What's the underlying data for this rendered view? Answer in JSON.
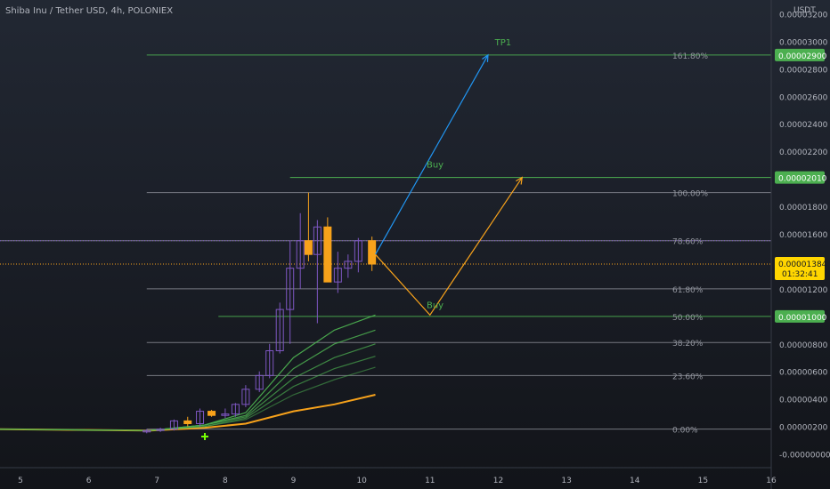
{
  "header": {
    "title": "Shiba Inu / Tether USD, 4h, POLONIEX"
  },
  "colors": {
    "up_candle": "#7e57c2",
    "down_candle": "#f7a21b",
    "grid_line": "#9598a1",
    "green_level": "#4caf50",
    "arrow_blue": "#2196f3",
    "arrow_orange": "#f7a21b",
    "price_label_bg": "#ffd600",
    "ma_fast": "#4caf50",
    "ma_slow": "#f7a21b"
  },
  "chart_data": {
    "type": "candlestick",
    "title": "Shiba Inu / Tether USD, 4h, POLONIEX",
    "ylabel": "USDT",
    "ylim": [
      -1e-07,
      3.3e-06
    ],
    "xlim": [
      4.7,
      16
    ],
    "x_ticks": [
      "5",
      "6",
      "7",
      "8",
      "9",
      "10",
      "11",
      "12",
      "13",
      "14",
      "15",
      "16"
    ],
    "x_tick_values": [
      5,
      6,
      7,
      8,
      9,
      10,
      11,
      12,
      13,
      14,
      15,
      16
    ],
    "y_ticks": [
      "0.00003200",
      "0.00003000",
      "0.00002800",
      "0.00002600",
      "0.00002400",
      "0.00002200",
      "0.00001800",
      "0.00001600",
      "0.00001200",
      "0.00000800",
      "0.00000600",
      "0.00000400",
      "0.00000200",
      "-0.00000000"
    ],
    "y_tick_values": [
      3.2e-06,
      3e-06,
      2.8e-06,
      2.6e-06,
      2.4e-06,
      2.2e-06,
      1.8e-06,
      1.6e-06,
      1.2e-06,
      8e-07,
      6e-07,
      4e-07,
      2e-07,
      0
    ],
    "fib_levels": [
      {
        "label": "161.80%",
        "value": 2.9e-06,
        "x_start": 6.85
      },
      {
        "label": "100.00%",
        "value": 1.9e-06,
        "x_start": 6.85
      },
      {
        "label": "78.60%",
        "value": 1.55e-06,
        "x_start": 4.7
      },
      {
        "label": "61.80%",
        "value": 1.2e-06,
        "x_start": 6.85
      },
      {
        "label": "50.00%",
        "value": 1e-06,
        "x_start": 7.9
      },
      {
        "label": "38.20%",
        "value": 8.1e-07,
        "x_start": 6.85
      },
      {
        "label": "23.60%",
        "value": 5.7e-07,
        "x_start": 6.85
      },
      {
        "label": "0.00%",
        "value": 1.8e-07,
        "x_start": 6.85
      }
    ],
    "price_labels": [
      {
        "text": "0.00002900",
        "value": 2.9e-06,
        "style": "green"
      },
      {
        "text": "0.00002010",
        "value": 2.01e-06,
        "style": "green"
      },
      {
        "text": "0.00001384",
        "value": 1.38e-06,
        "style": "yellow"
      },
      {
        "text": "0.00001000",
        "value": 1e-06,
        "style": "green"
      }
    ],
    "countdown": "01:32:41",
    "annotations": [
      {
        "text": "TP1",
        "x": 11.95,
        "value": 2.97e-06
      },
      {
        "text": "Buy",
        "x": 10.95,
        "value": 2.08e-06
      },
      {
        "text": "Buy",
        "x": 10.95,
        "value": 1.06e-06
      }
    ],
    "buy_level_line": {
      "value": 2.01e-06,
      "x_start": 8.95
    },
    "current_price": 1.38e-06,
    "prev_close_dotted": 1.55e-06,
    "arrows": [
      {
        "color": "blue",
        "points": [
          [
            10.2,
            1.45e-06
          ],
          [
            11.85,
            2.9e-06
          ]
        ]
      },
      {
        "color": "orange",
        "points": [
          [
            10.2,
            1.45e-06
          ],
          [
            11.0,
            1.01e-06
          ],
          [
            12.35,
            2.01e-06
          ]
        ]
      }
    ],
    "candles": [
      {
        "x": 6.85,
        "o": 1.6e-07,
        "h": 1.8e-07,
        "l": 1.5e-07,
        "c": 1.7e-07
      },
      {
        "x": 7.05,
        "o": 1.7e-07,
        "h": 1.9e-07,
        "l": 1.6e-07,
        "c": 1.8e-07
      },
      {
        "x": 7.25,
        "o": 1.8e-07,
        "h": 2.5e-07,
        "l": 1.7e-07,
        "c": 2.4e-07
      },
      {
        "x": 7.45,
        "o": 2.4e-07,
        "h": 2.7e-07,
        "l": 2e-07,
        "c": 2.2e-07
      },
      {
        "x": 7.63,
        "o": 2.2e-07,
        "h": 3.3e-07,
        "l": 2e-07,
        "c": 3.1e-07
      },
      {
        "x": 7.8,
        "o": 3.1e-07,
        "h": 3.2e-07,
        "l": 2.7e-07,
        "c": 2.8e-07
      },
      {
        "x": 8.0,
        "o": 2.8e-07,
        "h": 3.3e-07,
        "l": 2.6e-07,
        "c": 2.9e-07
      },
      {
        "x": 8.15,
        "o": 2.9e-07,
        "h": 3.7e-07,
        "l": 2.7e-07,
        "c": 3.6e-07
      },
      {
        "x": 8.3,
        "o": 3.6e-07,
        "h": 5e-07,
        "l": 3.4e-07,
        "c": 4.7e-07
      },
      {
        "x": 8.5,
        "o": 4.7e-07,
        "h": 6e-07,
        "l": 4.5e-07,
        "c": 5.7e-07
      },
      {
        "x": 8.65,
        "o": 5.7e-07,
        "h": 8e-07,
        "l": 5.5e-07,
        "c": 7.5e-07
      },
      {
        "x": 8.8,
        "o": 7.5e-07,
        "h": 1.1e-06,
        "l": 7.3e-07,
        "c": 1.05e-06
      },
      {
        "x": 8.95,
        "o": 1.05e-06,
        "h": 1.55e-06,
        "l": 8e-07,
        "c": 1.35e-06
      },
      {
        "x": 9.1,
        "o": 1.35e-06,
        "h": 1.75e-06,
        "l": 1.2e-06,
        "c": 1.55e-06
      },
      {
        "x": 9.22,
        "o": 1.55e-06,
        "h": 1.9e-06,
        "l": 1.4e-06,
        "c": 1.45e-06
      },
      {
        "x": 9.35,
        "o": 1.45e-06,
        "h": 1.7e-06,
        "l": 9.5e-07,
        "c": 1.65e-06
      },
      {
        "x": 9.5,
        "o": 1.65e-06,
        "h": 1.72e-06,
        "l": 1.25e-06,
        "c": 1.25e-06
      },
      {
        "x": 9.65,
        "o": 1.25e-06,
        "h": 1.47e-06,
        "l": 1.17e-06,
        "c": 1.35e-06
      },
      {
        "x": 9.8,
        "o": 1.35e-06,
        "h": 1.45e-06,
        "l": 1.28e-06,
        "c": 1.4e-06
      },
      {
        "x": 9.95,
        "o": 1.4e-06,
        "h": 1.57e-06,
        "l": 1.32e-06,
        "c": 1.55e-06
      },
      {
        "x": 10.15,
        "o": 1.55e-06,
        "h": 1.58e-06,
        "l": 1.33e-06,
        "c": 1.38e-06
      }
    ],
    "moving_averages": [
      {
        "color": "slow",
        "points": [
          [
            4.7,
            1.8e-07
          ],
          [
            6.9,
            1.7e-07
          ],
          [
            7.7,
            1.9e-07
          ],
          [
            8.3,
            2.2e-07
          ],
          [
            9.0,
            3.1e-07
          ],
          [
            9.6,
            3.6e-07
          ],
          [
            10.2,
            4.3e-07
          ]
        ]
      },
      {
        "color": "fast",
        "points": [
          [
            4.7,
            1.8e-07
          ],
          [
            6.9,
            1.7e-07
          ],
          [
            7.7,
            2e-07
          ],
          [
            8.3,
            2.5e-07
          ],
          [
            9.0,
            4.3e-07
          ],
          [
            9.6,
            5.4e-07
          ],
          [
            10.2,
            6.3e-07
          ]
        ]
      },
      {
        "color": "fast",
        "points": [
          [
            4.7,
            1.8e-07
          ],
          [
            6.9,
            1.7e-07
          ],
          [
            7.7,
            2e-07
          ],
          [
            8.3,
            2.6e-07
          ],
          [
            9.0,
            4.9e-07
          ],
          [
            9.6,
            6.2e-07
          ],
          [
            10.2,
            7.1e-07
          ]
        ]
      },
      {
        "color": "fast",
        "points": [
          [
            4.7,
            1.8e-07
          ],
          [
            6.9,
            1.7e-07
          ],
          [
            7.7,
            2.1e-07
          ],
          [
            8.3,
            2.7e-07
          ],
          [
            9.0,
            5.5e-07
          ],
          [
            9.6,
            7e-07
          ],
          [
            10.2,
            8e-07
          ]
        ]
      },
      {
        "color": "fast",
        "points": [
          [
            4.7,
            1.8e-07
          ],
          [
            6.9,
            1.7e-07
          ],
          [
            7.7,
            2.1e-07
          ],
          [
            8.3,
            2.8e-07
          ],
          [
            9.0,
            6.2e-07
          ],
          [
            9.6,
            8e-07
          ],
          [
            10.2,
            9e-07
          ]
        ]
      },
      {
        "color": "fast",
        "points": [
          [
            4.7,
            1.8e-07
          ],
          [
            6.9,
            1.7e-07
          ],
          [
            7.7,
            2.1e-07
          ],
          [
            8.3,
            3e-07
          ],
          [
            9.0,
            7e-07
          ],
          [
            9.6,
            9e-07
          ],
          [
            10.2,
            1.01e-06
          ]
        ]
      }
    ]
  }
}
